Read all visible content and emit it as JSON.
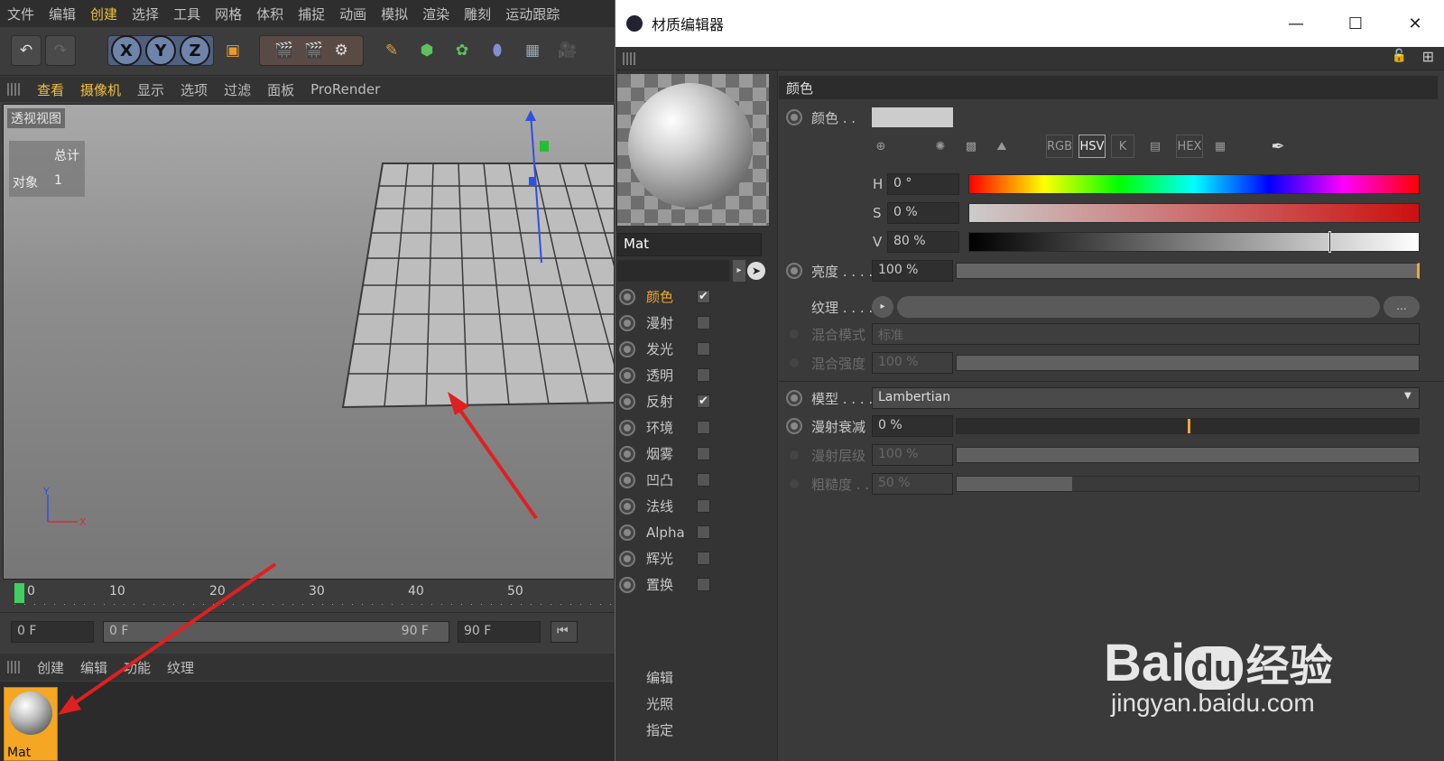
{
  "c4d": {
    "menu": [
      "文件",
      "编辑",
      "创建",
      "选择",
      "工具",
      "网格",
      "体积",
      "捕捉",
      "动画",
      "模拟",
      "渲染",
      "雕刻",
      "运动跟踪"
    ],
    "axis": [
      "X",
      "Y",
      "Z"
    ],
    "viewport_menu": [
      "查看",
      "摄像机",
      "显示",
      "选项",
      "过滤",
      "面板",
      "ProRender"
    ],
    "viewport_label": "透视视图",
    "hud": {
      "total_label": "总计",
      "object_label": "对象",
      "object_count": "1"
    },
    "axis_labels": {
      "y": "Y",
      "x": "X"
    },
    "timeline": {
      "ticks": [
        "0",
        "10",
        "20",
        "30",
        "40",
        "50"
      ]
    },
    "frames": {
      "current": "0 F",
      "range_start": "0 F",
      "range_end": "90 F",
      "max": "90 F"
    },
    "material_menu": [
      "创建",
      "编辑",
      "功能",
      "纹理"
    ],
    "material_name": "Mat"
  },
  "editor": {
    "title": "材质编辑器",
    "material_name": "Mat",
    "channels": [
      {
        "label": "颜色",
        "checked": true,
        "active": true
      },
      {
        "label": "漫射",
        "checked": false
      },
      {
        "label": "发光",
        "checked": false
      },
      {
        "label": "透明",
        "checked": false
      },
      {
        "label": "反射",
        "checked": true
      },
      {
        "label": "环境",
        "checked": false
      },
      {
        "label": "烟雾",
        "checked": false
      },
      {
        "label": "凹凸",
        "checked": false
      },
      {
        "label": "法线",
        "checked": false
      },
      {
        "label": "Alpha",
        "checked": false
      },
      {
        "label": "辉光",
        "checked": false
      },
      {
        "label": "置换",
        "checked": false
      }
    ],
    "extra_items": [
      "编辑",
      "光照",
      "指定"
    ],
    "section": "颜色",
    "color_label": "颜色 . .",
    "color_modes": [
      "RGB",
      "HSV",
      "K",
      "HEX"
    ],
    "hsv": {
      "h_label": "H",
      "h": "0 °",
      "s_label": "S",
      "s": "0 %",
      "v_label": "V",
      "v": "80 %",
      "v_fraction": 0.8
    },
    "brightness": {
      "label": "亮度 . . . .",
      "value": "100 %"
    },
    "texture": {
      "label": "纹理 . . . .",
      "button": "..."
    },
    "blend_mode": {
      "label": "混合模式",
      "value": "标准"
    },
    "blend_strength": {
      "label": "混合强度",
      "value": "100 %"
    },
    "model": {
      "label": "模型 . . . .",
      "value": "Lambertian"
    },
    "diffuse_falloff": {
      "label": "漫射衰减",
      "value": "0 %",
      "fraction": 0.5
    },
    "diffuse_level": {
      "label": "漫射层级",
      "value": "100 %"
    },
    "roughness": {
      "label": "粗糙度 . .",
      "value": "50 %",
      "fraction": 0.25
    },
    "colors": {
      "accent": "#f0a830",
      "swatch": "#cccccc"
    }
  },
  "watermark": {
    "brand": "Bai",
    "brand2": "du",
    "cn": "经验",
    "url": "jingyan.baidu.com"
  }
}
